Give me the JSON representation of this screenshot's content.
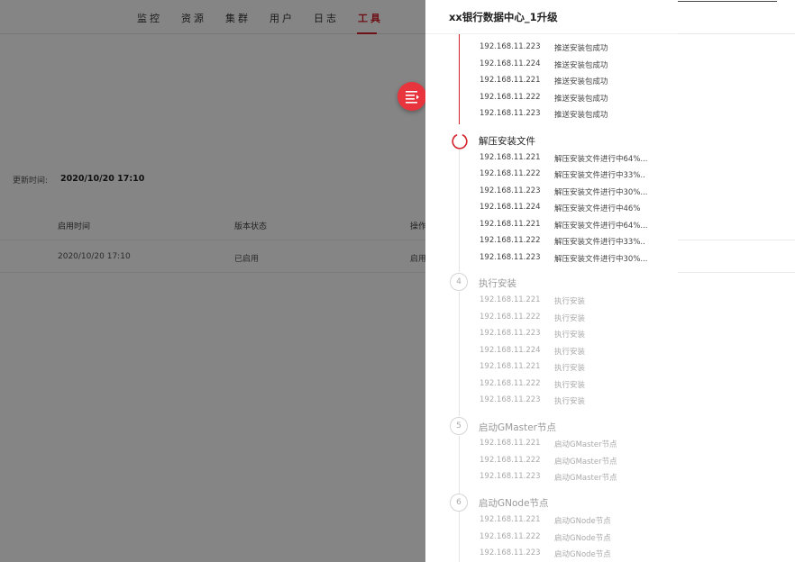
{
  "nav": {
    "items": [
      {
        "label": "监控"
      },
      {
        "label": "资源"
      },
      {
        "label": "集群"
      },
      {
        "label": "用户"
      },
      {
        "label": "日志"
      },
      {
        "label": "工具"
      }
    ],
    "active": "工具"
  },
  "page": {
    "update_label": "更新时间:",
    "update_value": "2020/10/20 17:10",
    "table": {
      "headers": [
        "启用时间",
        "版本状态",
        "操作"
      ],
      "rows": [
        [
          "2020/10/20 17:10",
          "已启用",
          "启用"
        ]
      ]
    }
  },
  "drawer": {
    "title": "xx银行数据中心_1升级",
    "push_entries": [
      {
        "ip": "192.168.11.223",
        "status": "推送安装包成功"
      },
      {
        "ip": "192.168.11.224",
        "status": "推送安装包成功"
      },
      {
        "ip": "192.168.11.221",
        "status": "推送安装包成功"
      },
      {
        "ip": "192.168.11.222",
        "status": "推送安装包成功"
      },
      {
        "ip": "192.168.11.223",
        "status": "推送安装包成功"
      }
    ],
    "steps": [
      {
        "number": "",
        "title": "解压安装文件",
        "state": "in-progress",
        "entries": [
          {
            "ip": "192.168.11.221",
            "status": "解压安装文件进行中64%..."
          },
          {
            "ip": "192.168.11.222",
            "status": "解压安装文件进行中33%.."
          },
          {
            "ip": "192.168.11.223",
            "status": "解压安装文件进行中30%..."
          },
          {
            "ip": "192.168.11.224",
            "status": "解压安装文件进行中46%"
          },
          {
            "ip": "192.168.11.221",
            "status": "解压安装文件进行中64%..."
          },
          {
            "ip": "192.168.11.222",
            "status": "解压安装文件进行中33%.."
          },
          {
            "ip": "192.168.11.223",
            "status": "解压安装文件进行中30%..."
          }
        ]
      },
      {
        "number": "4",
        "title": "执行安装",
        "state": "pending",
        "entries": [
          {
            "ip": "192.168.11.221",
            "status": "执行安装"
          },
          {
            "ip": "192.168.11.222",
            "status": "执行安装"
          },
          {
            "ip": "192.168.11.223",
            "status": "执行安装"
          },
          {
            "ip": "192.168.11.224",
            "status": "执行安装"
          },
          {
            "ip": "192.168.11.221",
            "status": "执行安装"
          },
          {
            "ip": "192.168.11.222",
            "status": "执行安装"
          },
          {
            "ip": "192.168.11.223",
            "status": "执行安装"
          }
        ]
      },
      {
        "number": "5",
        "title": "启动GMaster节点",
        "state": "pending",
        "entries": [
          {
            "ip": "192.168.11.221",
            "status": "启动GMaster节点"
          },
          {
            "ip": "192.168.11.222",
            "status": "启动GMaster节点"
          },
          {
            "ip": "192.168.11.223",
            "status": "启动GMaster节点"
          }
        ]
      },
      {
        "number": "6",
        "title": "启动GNode节点",
        "state": "pending",
        "entries": [
          {
            "ip": "192.168.11.221",
            "status": "启动GNode节点"
          },
          {
            "ip": "192.168.11.222",
            "status": "启动GNode节点"
          },
          {
            "ip": "192.168.11.223",
            "status": "启动GNode节点"
          }
        ]
      }
    ]
  },
  "colors": {
    "accent": "#d4222c",
    "fab": "#e8343d",
    "overlay": "rgba(0,0,0,0.48)"
  },
  "icons": {
    "fab": "list-collapse-icon",
    "in_progress": "spinner-icon"
  }
}
